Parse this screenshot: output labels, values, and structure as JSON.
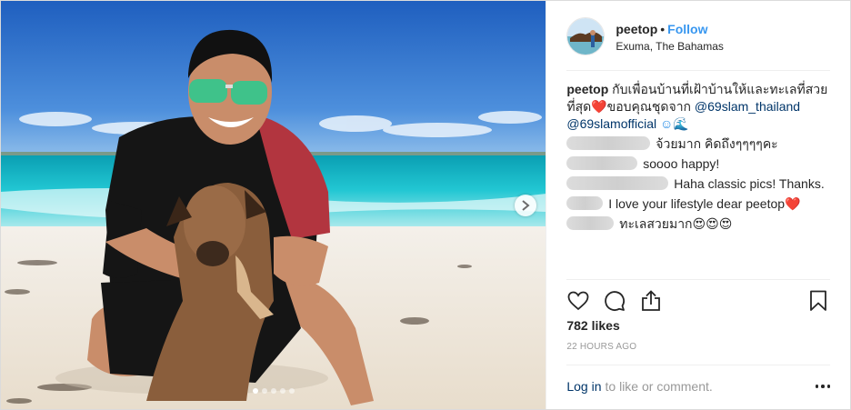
{
  "post": {
    "username": "peetop",
    "follow_label": "Follow",
    "location": "Exuma, The Bahamas",
    "carousel": {
      "total": 5,
      "active_index": 0
    }
  },
  "caption": {
    "username": "peetop",
    "text": "กับเพื่อนบ้านที่เฝ้าบ้านให้และทะเลที่สวยที่สุด",
    "heart": "❤️",
    "text2": "ขอบคุณชุดจาก ",
    "mention1": "@69slam_thailand",
    "mention2": "@69slamofficial",
    "emojis": " ☺🌊"
  },
  "comments": [
    {
      "text": "จ้วยมาก คิดถึงๆๆๆๆคะ"
    },
    {
      "text": "soooo happy!"
    },
    {
      "text": "Haha classic pics! Thanks."
    },
    {
      "text": "I love your lifestyle dear peetop",
      "emoji": "❤️"
    },
    {
      "text": "ทะเลสวยมาก",
      "emoji": "😍😍😍"
    }
  ],
  "icons": {
    "like": "heart-outline-icon",
    "comment": "speech-bubble-icon",
    "share": "share-upload-icon",
    "save": "bookmark-icon",
    "more": "ellipsis-icon",
    "next": "chevron-right-icon"
  },
  "stats": {
    "likes": "782 likes",
    "time": "22 HOURS AGO"
  },
  "footer": {
    "login_link": "Log in",
    "login_rest": "to like or comment."
  },
  "colors": {
    "link": "#003569",
    "follow": "#3897f0",
    "sky": "#2f75cf",
    "sea": "#1fc4cf",
    "sand": "#efe9df"
  }
}
